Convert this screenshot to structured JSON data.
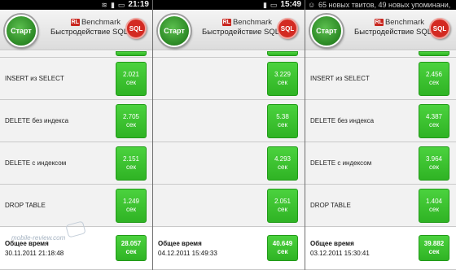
{
  "panels": [
    {
      "status": {
        "left_text": "",
        "time": "21:19"
      },
      "header": {
        "start_label": "Старт",
        "brand_badge": "RL",
        "brand_name": "Benchmark",
        "subtitle": "Быстродействие SQLite",
        "sql_badge": "SQL"
      },
      "rows": [
        {
          "label": "",
          "value": ""
        },
        {
          "label": "INSERT из SELECT",
          "value": "2.021",
          "unit": "сек"
        },
        {
          "label": "DELETE без индекса",
          "value": "2.705",
          "unit": "сек"
        },
        {
          "label": "DELETE с индексом",
          "value": "2.151",
          "unit": "сек"
        },
        {
          "label": "DROP TABLE",
          "value": "1.249",
          "unit": "сек"
        }
      ],
      "total": {
        "label": "Общее время",
        "datetime": "30.11.2011 21:18:48",
        "value": "28.057",
        "unit": "сек"
      }
    },
    {
      "status": {
        "left_text": "",
        "time": "15:49"
      },
      "header": {
        "start_label": "Старт",
        "brand_badge": "RL",
        "brand_name": "Benchmark",
        "subtitle": "Быстродействие SQLite",
        "sql_badge": "SQL"
      },
      "rows": [
        {
          "label": "",
          "value": ""
        },
        {
          "label": "",
          "value": "3.229",
          "unit": "сек"
        },
        {
          "label": "",
          "value": "5.38",
          "unit": "сек"
        },
        {
          "label": "",
          "value": "4.293",
          "unit": "сек"
        },
        {
          "label": "",
          "value": "2.051",
          "unit": "сек"
        }
      ],
      "total": {
        "label": "Общее время",
        "datetime": "04.12.2011 15:49:33",
        "value": "40.649",
        "unit": "сек"
      }
    },
    {
      "status": {
        "left_text": "65 новых твитов, 49 новых упоминани,",
        "time": ""
      },
      "header": {
        "start_label": "Старт",
        "brand_badge": "RL",
        "brand_name": "Benchmark",
        "subtitle": "Быстродействие SQLite",
        "sql_badge": "SQL"
      },
      "rows": [
        {
          "label": "",
          "value": ""
        },
        {
          "label": "INSERT из SELECT",
          "value": "2.456",
          "unit": "сек"
        },
        {
          "label": "DELETE без индекса",
          "value": "4.387",
          "unit": "сек"
        },
        {
          "label": "DELETE с индексом",
          "value": "3.964",
          "unit": "сек"
        },
        {
          "label": "DROP TABLE",
          "value": "1.404",
          "unit": "сек"
        }
      ],
      "total": {
        "label": "Общее время",
        "datetime": "03.12.2011 15:30:41",
        "value": "39.882",
        "unit": "сек"
      }
    }
  ],
  "watermark": "mobile-review.com",
  "colors": {
    "accent_green": "#2fb324",
    "start_green": "#2e8c27",
    "sql_red": "#d32a22"
  }
}
